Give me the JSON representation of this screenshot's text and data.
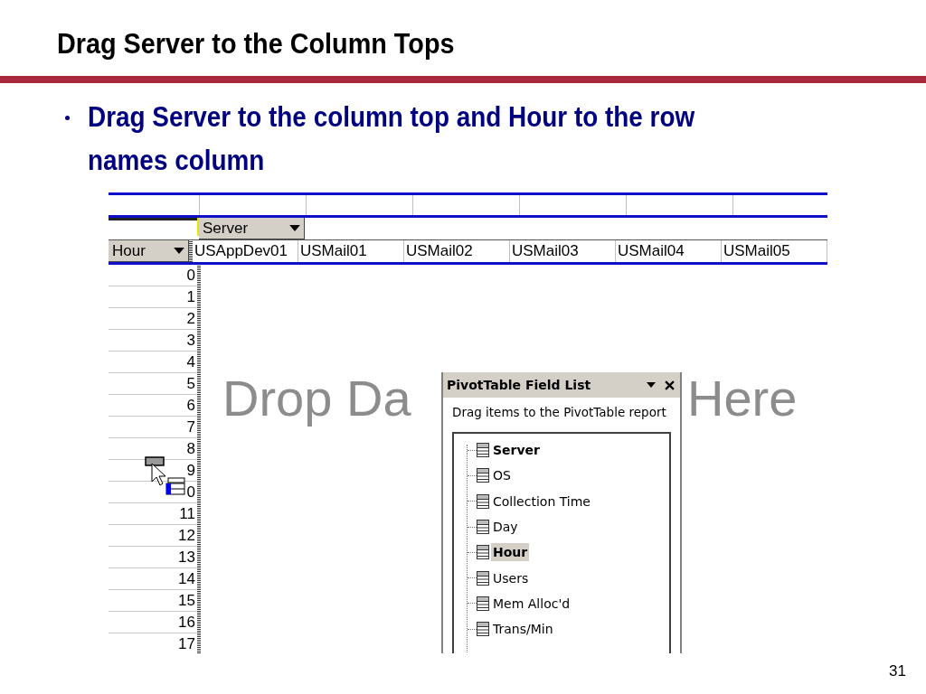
{
  "slide": {
    "title": "Drag Server to the Column Tops",
    "bullets": [
      "Drag Server to the column top and Hour to the row names column"
    ],
    "page_number": "31"
  },
  "pivot": {
    "column_field": "Server",
    "row_field": "Hour",
    "column_items": [
      "USAppDev01",
      "USMail01",
      "USMail02",
      "USMail03",
      "USMail04",
      "USMail05"
    ],
    "row_items": [
      "0",
      "1",
      "2",
      "3",
      "4",
      "5",
      "6",
      "7",
      "8",
      "9",
      "0",
      "11",
      "12",
      "13",
      "14",
      "15",
      "16",
      "17"
    ],
    "drop_hint_parts": [
      "Drop Da",
      "Here"
    ]
  },
  "field_list": {
    "title": "PivotTable Field List",
    "instruction": "Drag items to the PivotTable report",
    "fields": [
      {
        "label": "Server",
        "in_report": true,
        "selected": false
      },
      {
        "label": "OS",
        "in_report": false,
        "selected": false
      },
      {
        "label": "Collection Time",
        "in_report": false,
        "selected": false
      },
      {
        "label": "Day",
        "in_report": false,
        "selected": false
      },
      {
        "label": "Hour",
        "in_report": true,
        "selected": true
      },
      {
        "label": "Users",
        "in_report": false,
        "selected": false
      },
      {
        "label": "Mem Alloc'd",
        "in_report": false,
        "selected": false
      },
      {
        "label": "Trans/Min",
        "in_report": false,
        "selected": false
      }
    ]
  }
}
